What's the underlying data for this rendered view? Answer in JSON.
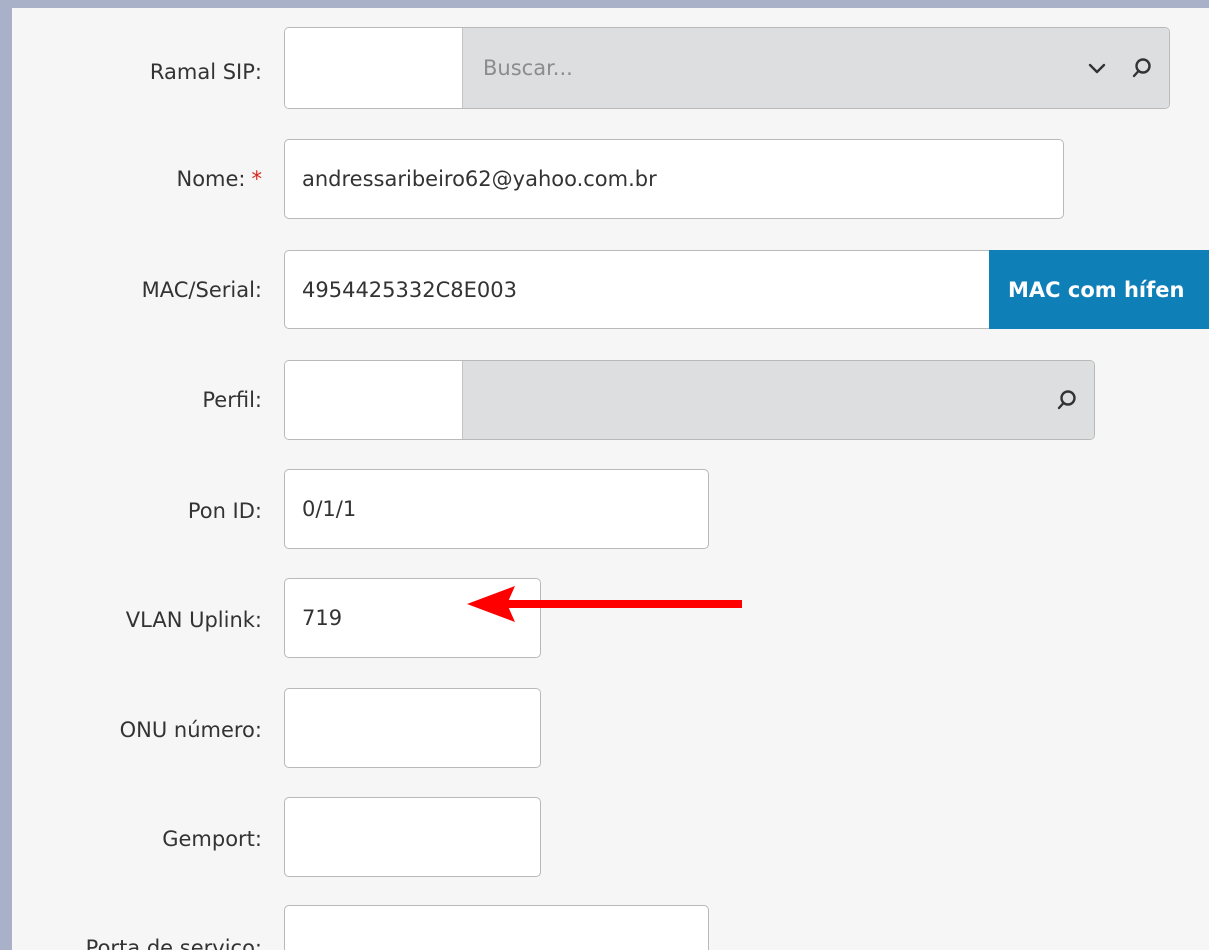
{
  "form": {
    "ramal_sip": {
      "label": "Ramal SIP:",
      "search_placeholder": "Buscar..."
    },
    "nome": {
      "label": "Nome:",
      "required_mark": "*",
      "value": "andressaribeiro62@yahoo.com.br"
    },
    "mac_serial": {
      "label": "MAC/Serial:",
      "value": "4954425332C8E003",
      "button_label": "MAC com hífen"
    },
    "perfil": {
      "label": "Perfil:"
    },
    "pon_id": {
      "label": "Pon ID:",
      "value": "0/1/1"
    },
    "vlan_uplink": {
      "label": "VLAN Uplink:",
      "value": "719"
    },
    "onu_numero": {
      "label": "ONU número:",
      "value": ""
    },
    "gemport": {
      "label": "Gemport:",
      "value": ""
    },
    "porta_servico": {
      "label": "Porta de serviço:",
      "value": ""
    }
  },
  "colors": {
    "accent_button": "#0f7fb8",
    "required": "#d9251c",
    "annotation_arrow": "#ff0000",
    "frame": "#a9b1c8"
  },
  "icons": {
    "dropdown": "chevron-down-icon",
    "search": "search-icon",
    "annotation": "red-arrow-icon"
  }
}
